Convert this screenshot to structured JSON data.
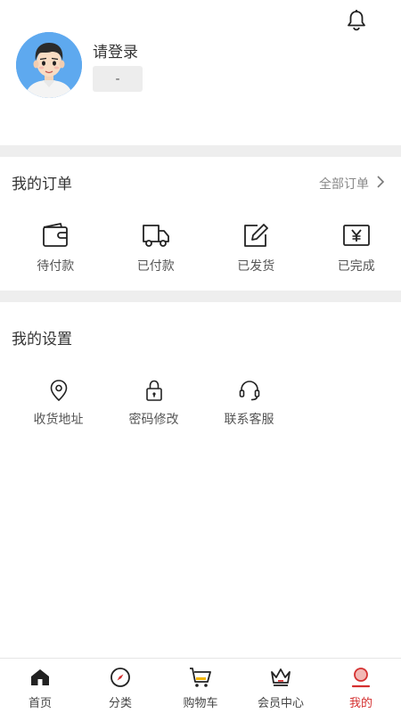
{
  "profile": {
    "login_prompt": "请登录",
    "level": "-"
  },
  "orders": {
    "title": "我的订单",
    "all_orders": "全部订单",
    "items": [
      {
        "label": "待付款",
        "icon": "wallet-icon"
      },
      {
        "label": "已付款",
        "icon": "truck-icon"
      },
      {
        "label": "已发货",
        "icon": "edit-icon"
      },
      {
        "label": "已完成",
        "icon": "yen-icon"
      }
    ]
  },
  "settings": {
    "title": "我的设置",
    "items": [
      {
        "label": "收货地址",
        "icon": "location-pin-icon"
      },
      {
        "label": "密码修改",
        "icon": "lock-icon"
      },
      {
        "label": "联系客服",
        "icon": "headset-icon"
      }
    ]
  },
  "tabbar": {
    "items": [
      {
        "label": "首页",
        "icon": "home-icon"
      },
      {
        "label": "分类",
        "icon": "compass-icon"
      },
      {
        "label": "购物车",
        "icon": "cart-icon"
      },
      {
        "label": "会员中心",
        "icon": "crown-icon"
      },
      {
        "label": "我的",
        "icon": "user-icon",
        "active": true
      }
    ]
  },
  "colors": {
    "accent": "#d43030",
    "divider": "#eeeeee",
    "avatar_bg": "#5ea9ef"
  }
}
